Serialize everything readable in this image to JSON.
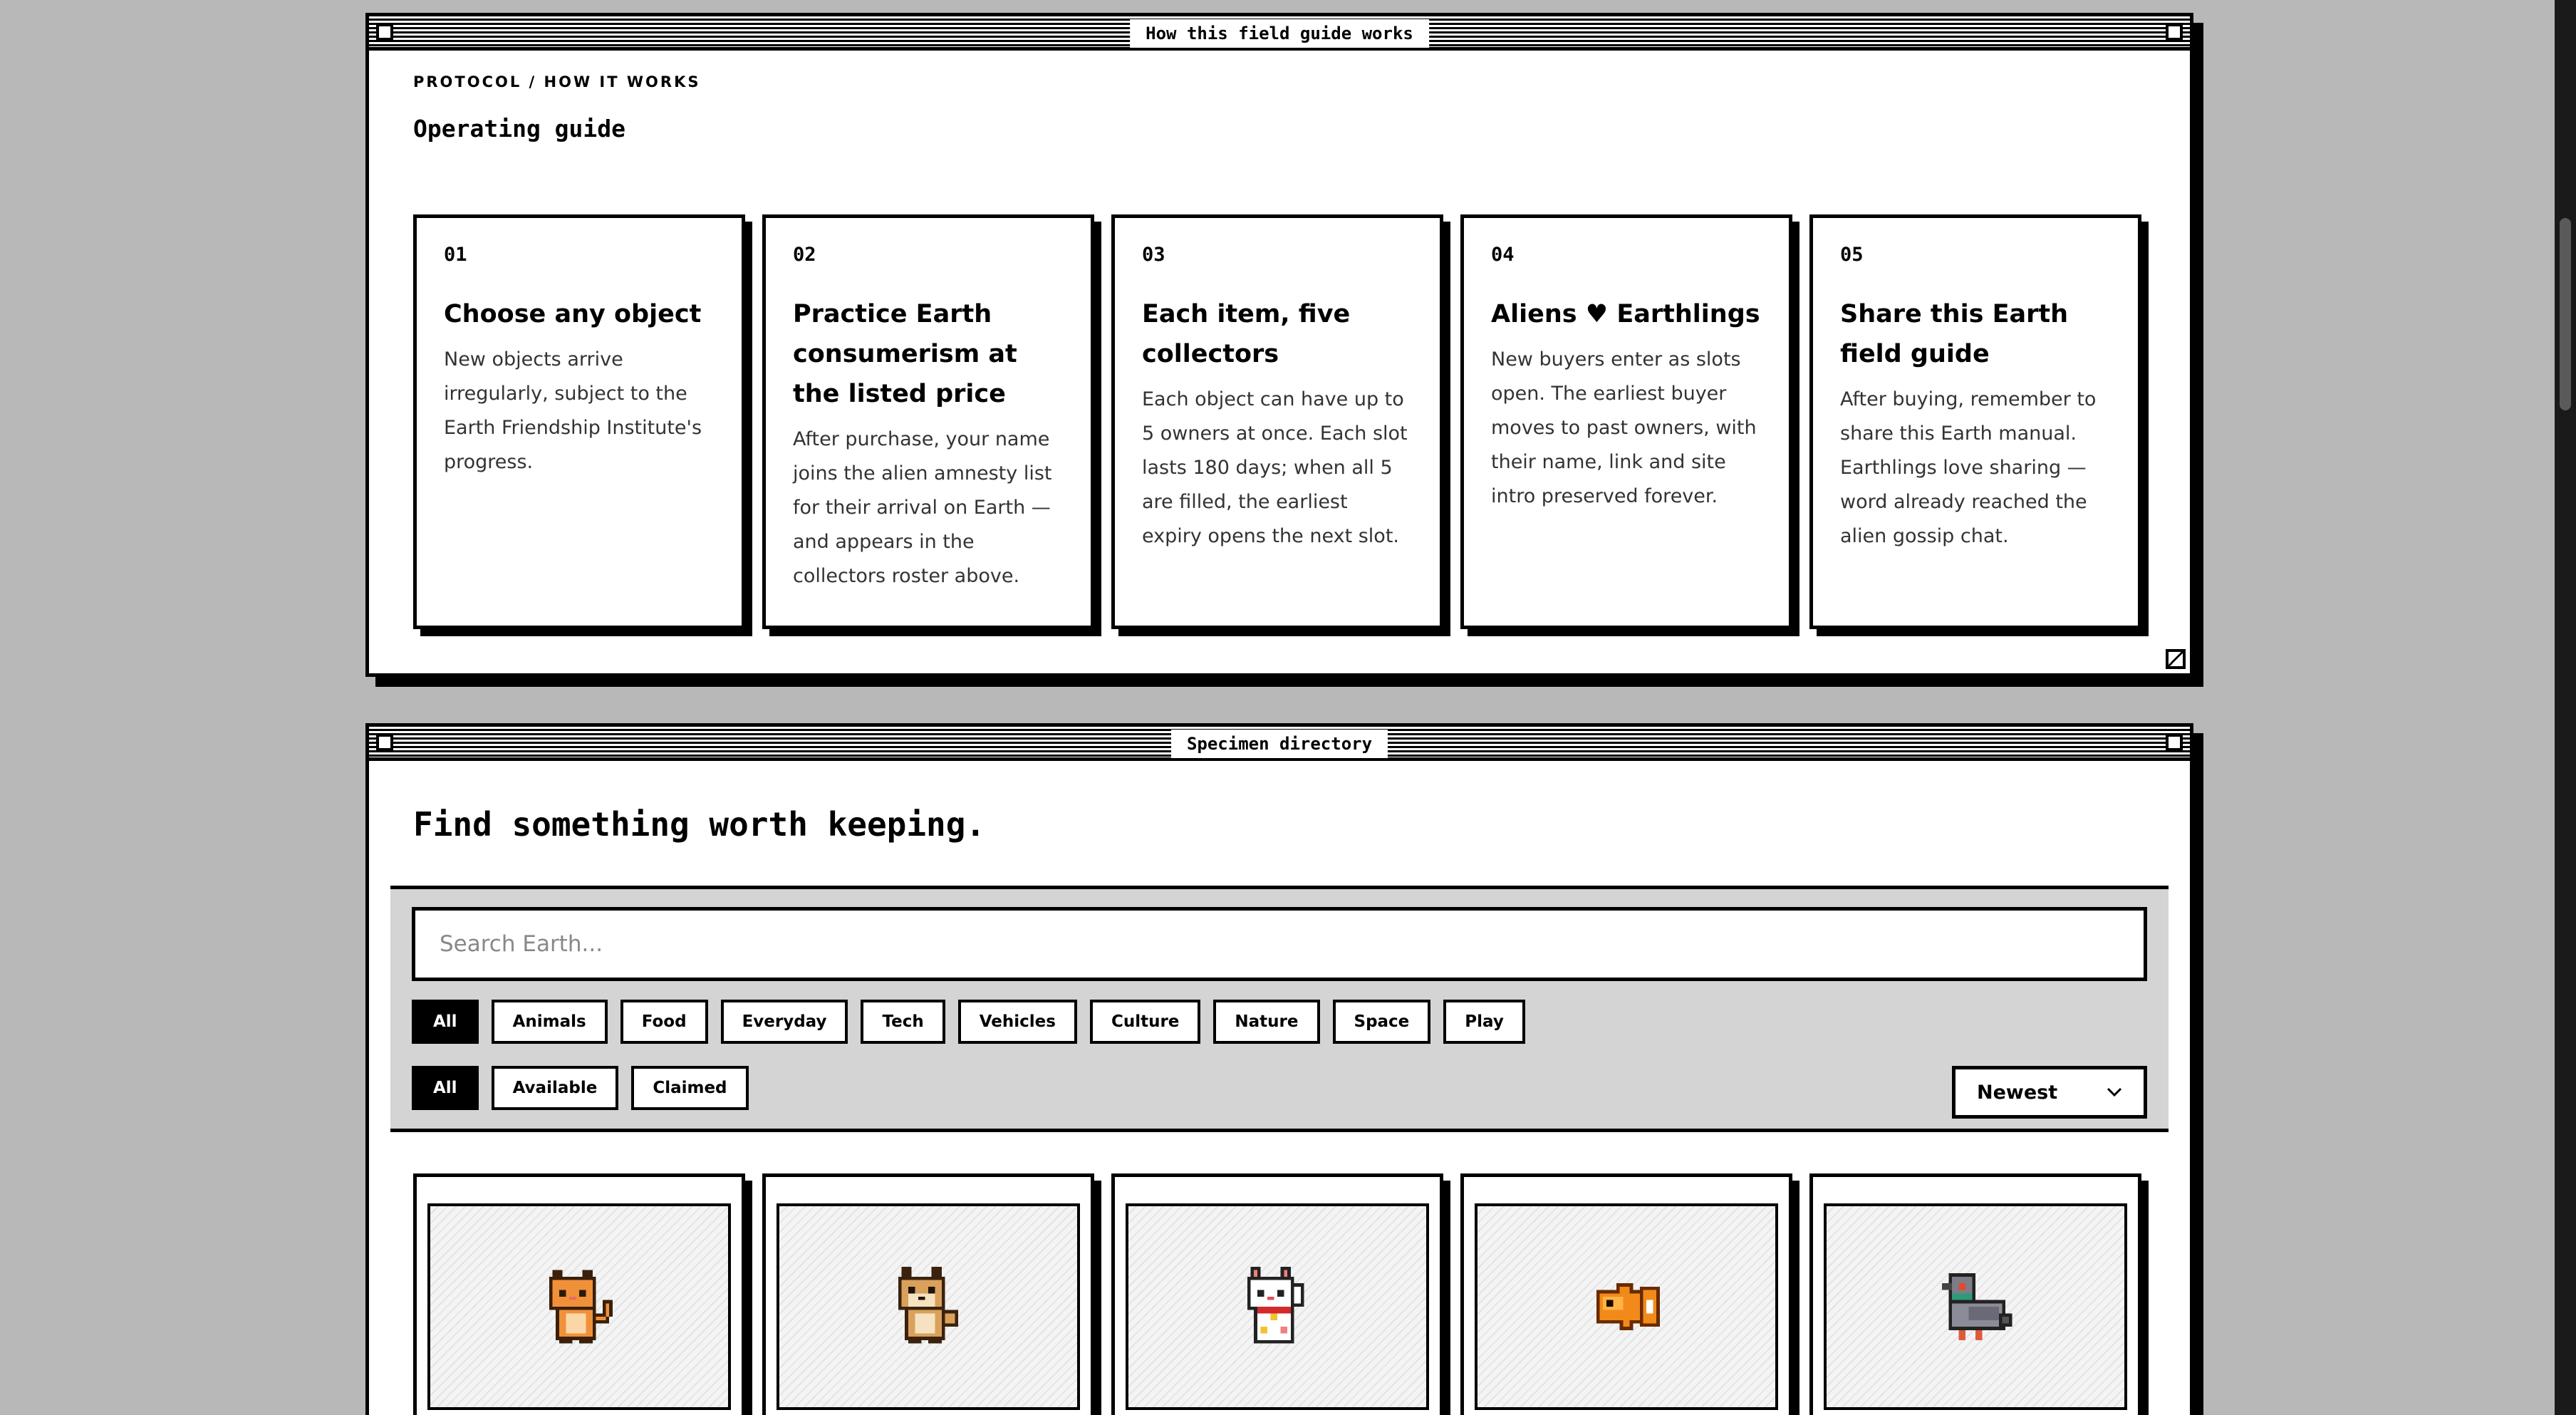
{
  "guide_window": {
    "title": "How this field guide works",
    "kicker": "PROTOCOL / HOW IT WORKS",
    "heading": "Operating guide",
    "steps": [
      {
        "num": "01",
        "title": "Choose any object",
        "body": "New objects arrive irregularly, subject to the Earth Friendship Institute's progress."
      },
      {
        "num": "02",
        "title": "Practice Earth consumerism at the listed price",
        "body": "After purchase, your name joins the alien amnesty list for their arrival on Earth — and appears in the collectors roster above."
      },
      {
        "num": "03",
        "title": "Each item, five collectors",
        "body": "Each object can have up to 5 owners at once. Each slot lasts 180 days; when all 5 are filled, the earliest expiry opens the next slot."
      },
      {
        "num": "04",
        "title_before": "Aliens",
        "title_after": "Earthlings",
        "body": "New buyers enter as slots open. The earliest buyer moves to past owners, with their name, link and site intro preserved forever."
      },
      {
        "num": "05",
        "title": "Share this Earth field guide",
        "body": "After buying, remember to share this Earth manual. Earthlings love sharing — word already reached the alien gossip chat."
      }
    ]
  },
  "directory_window": {
    "title": "Specimen directory",
    "headline": "Find something worth keeping.",
    "search_placeholder": "Search Earth...",
    "categories": [
      "All",
      "Animals",
      "Food",
      "Everyday",
      "Tech",
      "Vehicles",
      "Culture",
      "Nature",
      "Space",
      "Play"
    ],
    "statuses": [
      "All",
      "Available",
      "Claimed"
    ],
    "sort": {
      "selected": "Newest"
    },
    "items": [
      {
        "icon": "orange-cat-icon"
      },
      {
        "icon": "shiba-dog-icon"
      },
      {
        "icon": "lucky-cat-icon"
      },
      {
        "icon": "goldfish-icon"
      },
      {
        "icon": "pigeon-icon"
      }
    ]
  },
  "colors": {
    "background": "#b8b8b8",
    "panel": "#d4d4d4",
    "ink": "#000000"
  }
}
